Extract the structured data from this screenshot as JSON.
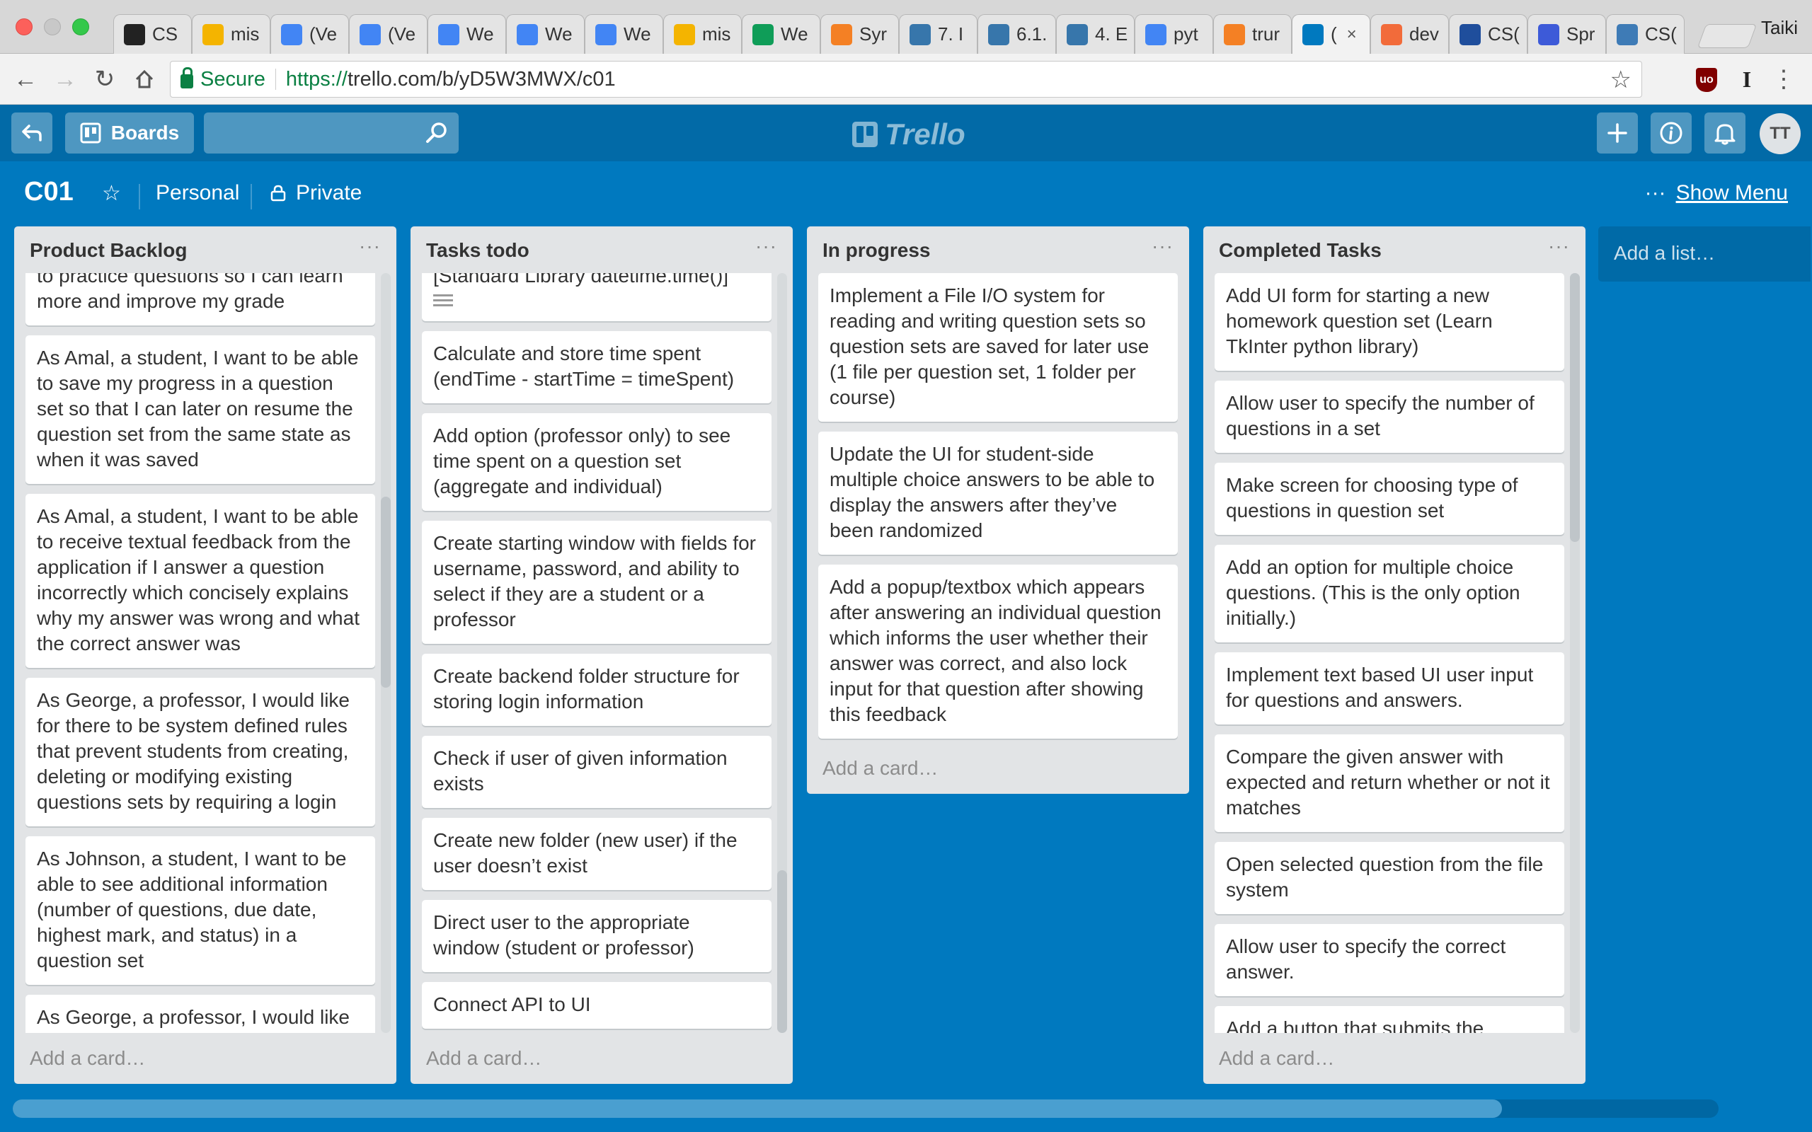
{
  "browser": {
    "tabs": [
      {
        "title": "CS",
        "icon": "github-icon",
        "color": "#222222"
      },
      {
        "title": "mis",
        "icon": "google-drive-icon",
        "color": "#f4b400"
      },
      {
        "title": "(Ve",
        "icon": "google-docs-icon",
        "color": "#4285f4"
      },
      {
        "title": "(Ve",
        "icon": "google-docs-icon",
        "color": "#4285f4"
      },
      {
        "title": "We",
        "icon": "google-docs-icon",
        "color": "#4285f4"
      },
      {
        "title": "We",
        "icon": "google-docs-icon",
        "color": "#4285f4"
      },
      {
        "title": "We",
        "icon": "google-docs-icon",
        "color": "#4285f4"
      },
      {
        "title": "mis",
        "icon": "google-drive-icon",
        "color": "#f4b400"
      },
      {
        "title": "We",
        "icon": "google-sheets-icon",
        "color": "#0f9d58"
      },
      {
        "title": "Syr",
        "icon": "stackoverflow-icon",
        "color": "#f48024"
      },
      {
        "title": "7. I",
        "icon": "python-icon",
        "color": "#3776ab"
      },
      {
        "title": "6.1.",
        "icon": "python-icon",
        "color": "#3776ab"
      },
      {
        "title": "4. E",
        "icon": "python-icon",
        "color": "#3776ab"
      },
      {
        "title": "pyt",
        "icon": "google-icon",
        "color": "#4285f4"
      },
      {
        "title": "trur",
        "icon": "stackoverflow-icon",
        "color": "#f48024"
      },
      {
        "title": "(",
        "icon": "trello-icon",
        "color": "#0079bf",
        "active": true
      },
      {
        "title": "dev",
        "icon": "devdocs-icon",
        "color": "#f26b3a"
      },
      {
        "title": "CS(",
        "icon": "utsc-icon",
        "color": "#1f4e9c"
      },
      {
        "title": "Spr",
        "icon": "sprint-icon",
        "color": "#3d5ad8"
      },
      {
        "title": "CS(",
        "icon": "piazza-icon",
        "color": "#3e7bb6"
      }
    ],
    "profile_name": "Taiki",
    "address": {
      "secure_label": "Secure",
      "url_scheme": "https://",
      "url_rest": "trello.com/b/yD5W3MWX/c01"
    }
  },
  "header": {
    "boards_label": "Boards",
    "logo_text": "Trello",
    "avatar_initials": "TT"
  },
  "board": {
    "title": "C01",
    "team": "Personal",
    "visibility": "Private",
    "show_menu": "Show Menu",
    "menu_dots": "···"
  },
  "lists": [
    {
      "title": "Product Backlog",
      "menu": "···",
      "add_card": "Add a card…",
      "cards": [
        "As Amal, a student, I want to be able to practice questions so I can learn more and improve my grade",
        "As Amal, a student, I want to be able to save my progress in a question set so that I can later on resume the question set from the same state as when it was saved",
        "As Amal, a student, I want to be able to receive textual feedback from the application if I answer a question incorrectly which concisely explains why my answer was wrong and what the correct answer was",
        "As George, a professor, I would like for there to be system defined rules that prevent students from creating, deleting or modifying existing questions sets by requiring a login",
        "As Johnson, a student, I want to be able to see additional information (number of questions, due date, highest mark, and status) in a question set",
        "As George, a professor, I would like to be able specify a deadline date for a question set"
      ]
    },
    {
      "title": "Tasks todo",
      "menu": "···",
      "add_card": "Add a card…",
      "cards": [
        "[Standard Library datetime.time()]",
        "Calculate and store time spent (endTime - startTime = timeSpent)",
        "Add option (professor only) to see time spent on a question set (aggregate and individual)",
        "Create starting window with fields for username, password, and ability to select if they are a student or a professor",
        "Create backend folder structure for storing login information",
        "Check if user of given information exists",
        "Create new folder (new user) if the user doesn’t exist",
        "Direct user to the appropriate window (student or professor)",
        "Connect API to UI"
      ]
    },
    {
      "title": "In progress",
      "menu": "···",
      "add_card": "Add a card…",
      "cards": [
        "Implement a File I/O system for reading and writing question sets so question sets are saved for later use (1 file per question set, 1 folder per course)",
        "Update the UI for student-side multiple choice answers to be able to display the answers after they’ve been randomized",
        "Add a popup/textbox which appears after answering an individual question which informs the user whether their answer was correct, and also lock input for that question after showing this feedback"
      ]
    },
    {
      "title": "Completed Tasks",
      "menu": "···",
      "add_card": "Add a card…",
      "cards": [
        "Add UI form for starting a new homework question set (Learn TkInter python library)",
        "Allow user to specify the number of questions in a set",
        "Make screen for choosing type of questions in question set",
        "Add an option for multiple choice questions. (This is the only option initially.)",
        "Implement text based UI user input for questions and answers.",
        "Compare the given answer with expected and return whether or not it matches",
        "Open selected question from the file system",
        "Allow user to specify the correct answer.",
        "Add a button that submits the answer selected"
      ]
    }
  ],
  "add_list": "Add a list…"
}
